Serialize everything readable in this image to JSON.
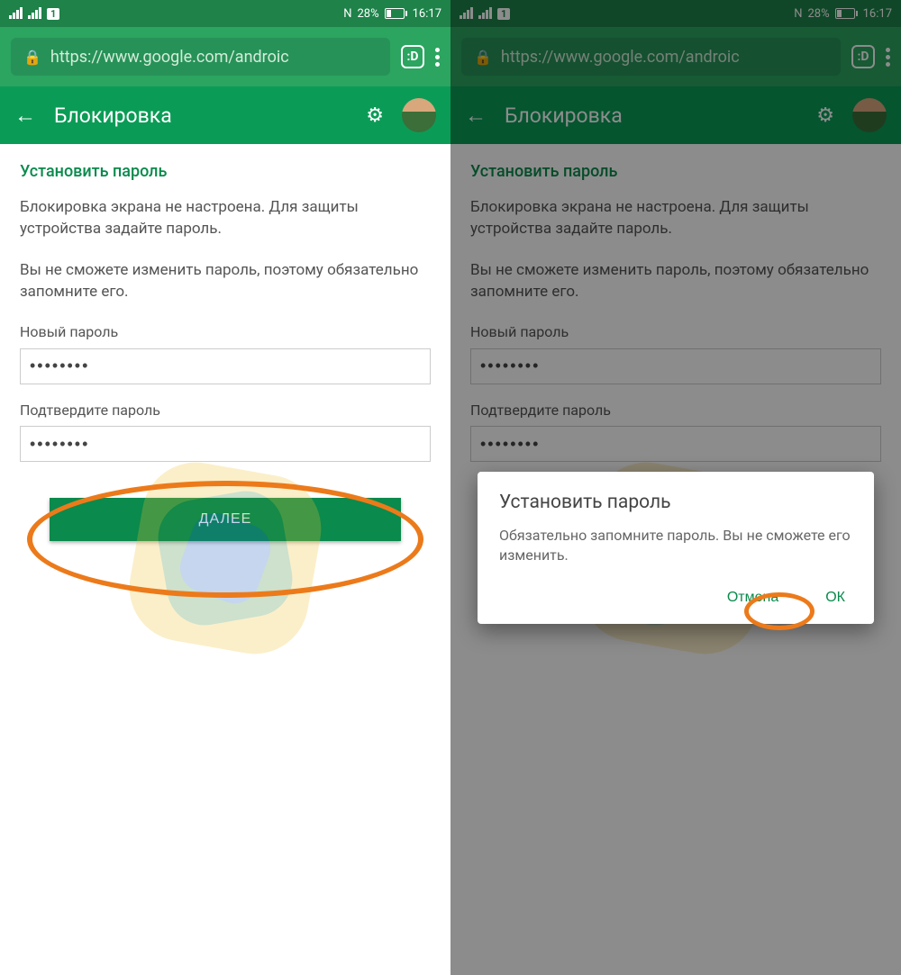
{
  "status": {
    "sim": "1",
    "nfc": "N",
    "battery": "28%",
    "time": "16:17"
  },
  "browser": {
    "url": "https://www.google.com/androic",
    "tab_indicator": ":D"
  },
  "appbar": {
    "title": "Блокировка"
  },
  "page": {
    "section_title": "Установить пароль",
    "desc1": "Блокировка экрана не настроена. Для защиты устройства задайте пароль.",
    "desc2": "Вы не сможете изменить пароль, поэтому обязательно запомните его.",
    "new_password_label": "Новый пароль",
    "confirm_password_label": "Подтвердите пароль",
    "password_value": "••••••••",
    "next_button": "ДАЛЕЕ"
  },
  "dialog": {
    "title": "Установить пароль",
    "body": "Обязательно запомните пароль. Вы не сможете его изменить.",
    "cancel": "Отмена",
    "ok": "ОК"
  }
}
